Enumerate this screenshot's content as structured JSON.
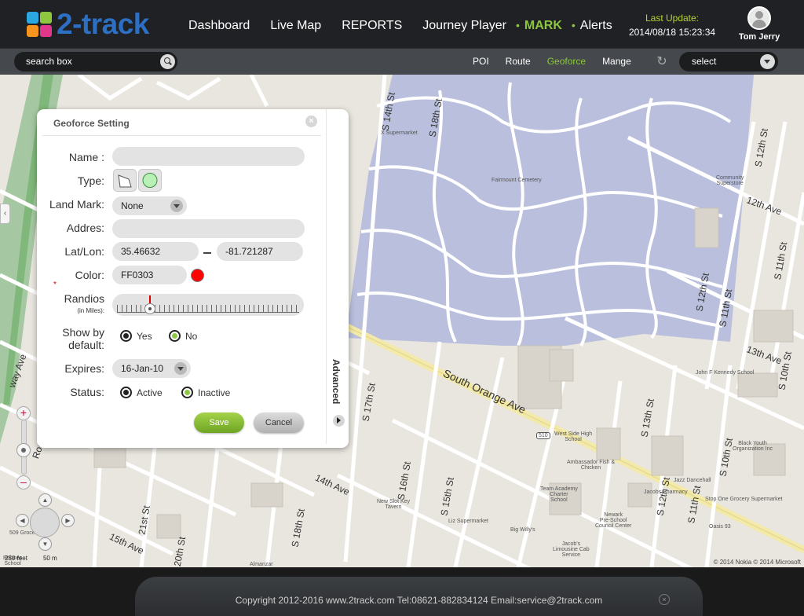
{
  "app": {
    "logo_text": "2-track",
    "logo_colors": [
      "#2ca8e0",
      "#8dc63f",
      "#f7941d",
      "#e0368c"
    ]
  },
  "nav": {
    "items": [
      {
        "label": "Dashboard",
        "active": false
      },
      {
        "label": "Live Map",
        "active": false
      },
      {
        "label": "REPORTS",
        "active": false
      },
      {
        "label": "Journey Player",
        "active": false
      },
      {
        "label": "MARK",
        "active": true
      },
      {
        "label": "Alerts",
        "active": false
      }
    ],
    "accent_color": "#8dc63f"
  },
  "update": {
    "label": "Last Update:",
    "time": "2014/08/18  15:23:34"
  },
  "user": {
    "name": "Tom Jerry"
  },
  "subbar": {
    "search_value": "search box",
    "tabs": [
      {
        "label": "POI",
        "active": false
      },
      {
        "label": "Route",
        "active": false
      },
      {
        "label": "Geoforce",
        "active": true
      },
      {
        "label": "Mange",
        "active": false
      }
    ],
    "select_value": "select"
  },
  "map": {
    "streets": [
      "S 18th St",
      "S 14th St",
      "S 12th St",
      "S 12th St",
      "S 11th St",
      "S 11th St",
      "S 10th St",
      "12th Ave",
      "13th Ave",
      "14th Ave",
      "15th Ave",
      "South Orange Ave",
      "S 17th St",
      "S 16th St",
      "S 15th St",
      "S 18th St",
      "20th St",
      "21st St",
      "S 13th St",
      "S 12th St",
      "S 11th St",
      "S 10th St",
      "way Ave",
      "Rod Ave"
    ],
    "places": [
      "X Supermarket",
      "Fairmount Cemetery",
      "Community Superstore",
      "John F Kennedy School",
      "West Side High School",
      "Ambassador Fish & Chicken",
      "Jazz Dancehall",
      "Team Academy Charter School",
      "Jacobs Pharmacy",
      "New Slot Key Tavern",
      "Liz Supermarket",
      "Stop One Grocery Supermarket",
      "Newark Pre-School Council Center",
      "Big Willy's",
      "Black Youth Organization Inc",
      "Jacob's Limousine Cab Service",
      "Oasis 93",
      "Almanzar",
      "509 Grocery",
      "Rohnes School"
    ],
    "route_badge": "510",
    "copyright": "© 2014 Nokia  © 2014 Microsoft",
    "scale_feet": "250 feet",
    "scale_m": "50 m"
  },
  "dialog": {
    "title": "Geoforce Setting",
    "labels": {
      "name": "Name :",
      "type": "Type:",
      "landmark": "Land Mark:",
      "address": "Addres:",
      "latlon": "Lat/Lon:",
      "color": "Color:",
      "radius": "Randios",
      "radius_unit": "(in Miles):",
      "show_default": "Show by default:",
      "expires": "Expires:",
      "status": "Status:"
    },
    "name_value": "",
    "landmark_value": "None",
    "address_value": "",
    "lat": "35.46632",
    "lon": "-81.721287",
    "color_value": "FF0303",
    "color_hex": "#ff0303",
    "radius_fraction": 0.18,
    "show_yes": "Yes",
    "show_no": "No",
    "show_selected": "No",
    "expires_value": "16-Jan-10",
    "status_active": "Active",
    "status_inactive": "Inactive",
    "status_selected": "Inactive",
    "save_label": "Save",
    "cancel_label": "Cancel",
    "advanced_label": "Advanced"
  },
  "footer": {
    "text": "Copyright   2012-2016 www.2track.com     Tel:08621-882834124    Email:service@2track.com"
  }
}
